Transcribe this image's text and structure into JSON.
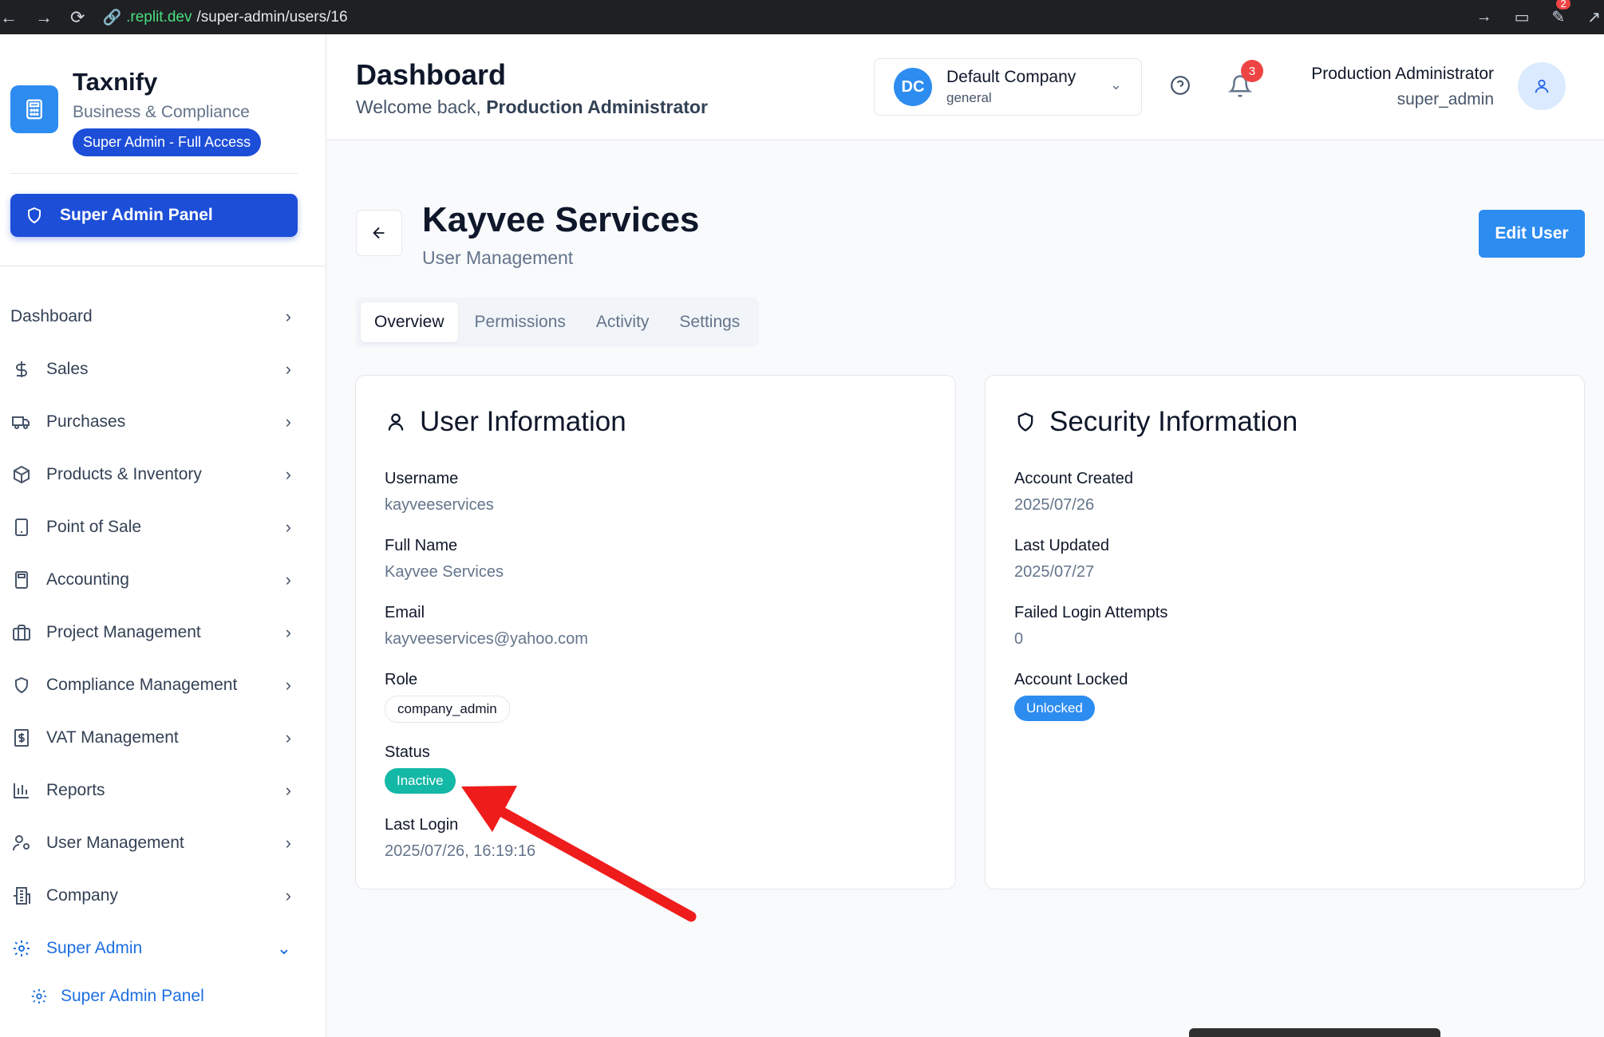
{
  "browser": {
    "url_host": ".replit.dev",
    "url_path": "/super-admin/users/16",
    "ext_badge": "2"
  },
  "sidebar": {
    "brand_name": "Taxnify",
    "brand_sub": "Business & Compliance",
    "access_pill": "Super Admin - Full Access",
    "panel_button": "Super Admin Panel",
    "items": [
      {
        "label": "Dashboard",
        "icon": "none"
      },
      {
        "label": "Sales",
        "icon": "dollar-icon"
      },
      {
        "label": "Purchases",
        "icon": "truck-icon"
      },
      {
        "label": "Products & Inventory",
        "icon": "package-icon"
      },
      {
        "label": "Point of Sale",
        "icon": "tablet-icon"
      },
      {
        "label": "Accounting",
        "icon": "calculator-icon"
      },
      {
        "label": "Project Management",
        "icon": "briefcase-icon"
      },
      {
        "label": "Compliance Management",
        "icon": "shield-icon"
      },
      {
        "label": "VAT Management",
        "icon": "receipt-icon"
      },
      {
        "label": "Reports",
        "icon": "bar-chart-icon"
      },
      {
        "label": "User Management",
        "icon": "user-cog-icon"
      },
      {
        "label": "Company",
        "icon": "building-icon"
      },
      {
        "label": "Super Admin",
        "icon": "gear-icon"
      }
    ],
    "sub_item": "Super Admin Panel"
  },
  "header": {
    "title": "Dashboard",
    "welcome_prefix": "Welcome back, ",
    "welcome_name": "Production Administrator",
    "company_initials": "DC",
    "company_name": "Default Company",
    "company_type": "general",
    "notifications": "3",
    "user_name": "Production Administrator",
    "user_role": "super_admin"
  },
  "page": {
    "title": "Kayvee Services",
    "subtitle": "User Management",
    "edit_button": "Edit User",
    "tabs": [
      "Overview",
      "Permissions",
      "Activity",
      "Settings"
    ],
    "active_tab": "Overview"
  },
  "user_info": {
    "title": "User Information",
    "username_label": "Username",
    "username": "kayveeservices",
    "fullname_label": "Full Name",
    "fullname": "Kayvee Services",
    "email_label": "Email",
    "email": "kayveeservices@yahoo.com",
    "role_label": "Role",
    "role": "company_admin",
    "status_label": "Status",
    "status": "Inactive",
    "last_login_label": "Last Login",
    "last_login": "2025/07/26, 16:19:16"
  },
  "security_info": {
    "title": "Security Information",
    "created_label": "Account Created",
    "created": "2025/07/26",
    "updated_label": "Last Updated",
    "updated": "2025/07/27",
    "failed_label": "Failed Login Attempts",
    "failed": "0",
    "locked_label": "Account Locked",
    "locked": "Unlocked"
  },
  "colors": {
    "primary": "#2d8cf0",
    "brand_blue": "#1d4ed8",
    "status_teal": "#14b8a6",
    "annotation_red": "#ef1c1c"
  }
}
